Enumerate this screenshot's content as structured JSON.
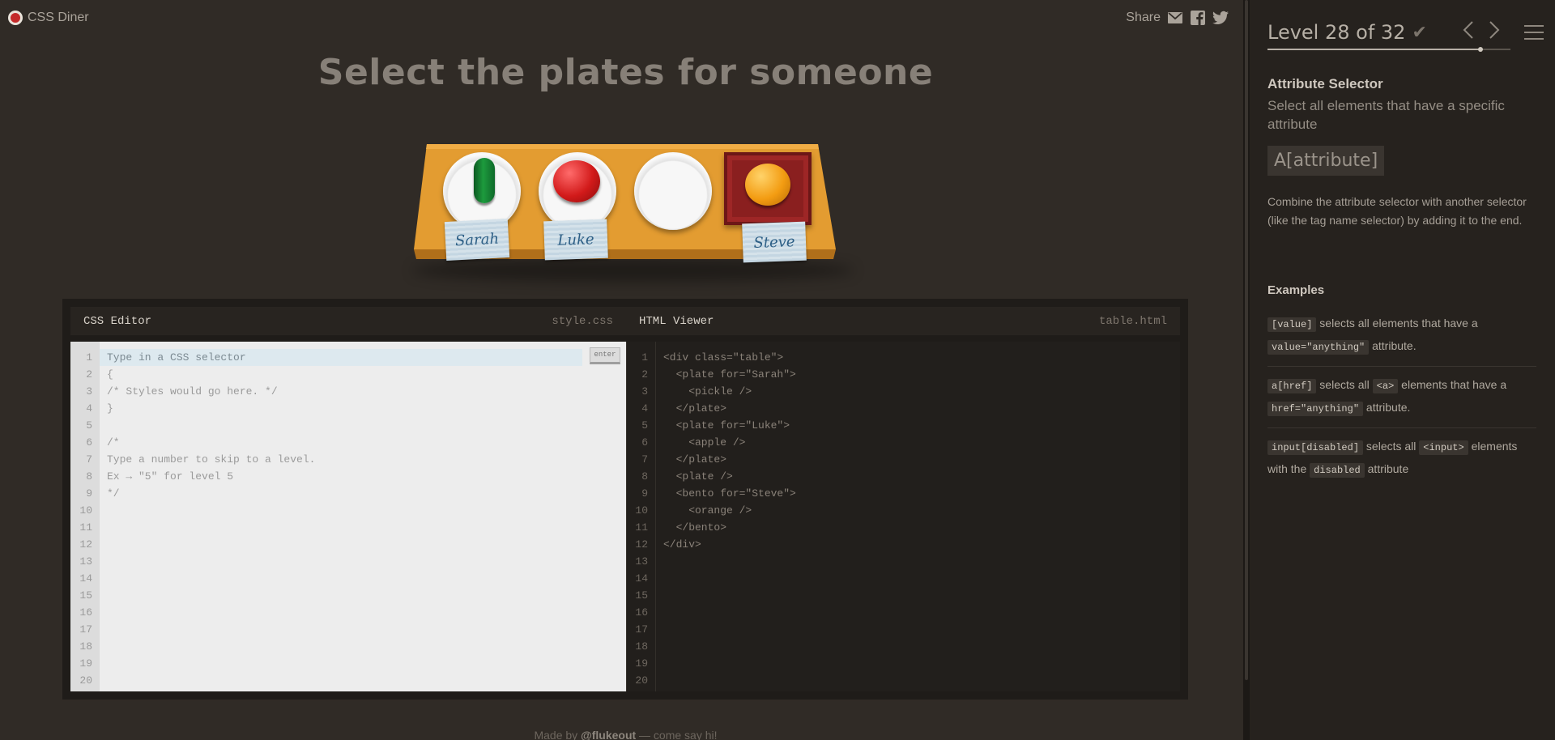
{
  "app": {
    "name": "CSS Diner"
  },
  "share": {
    "label": "Share",
    "icons": [
      "mail-icon",
      "facebook-icon",
      "twitter-icon"
    ]
  },
  "order": "Select the plates for someone",
  "table": {
    "items": [
      {
        "type": "plate",
        "contains": "pickle",
        "tag": "Sarah"
      },
      {
        "type": "plate",
        "contains": "apple",
        "tag": "Luke"
      },
      {
        "type": "plate",
        "contains": "",
        "tag": ""
      },
      {
        "type": "bento",
        "contains": "orange",
        "tag": "Steve"
      }
    ]
  },
  "css_editor": {
    "title": "CSS Editor",
    "file": "style.css",
    "placeholder": "Type in a CSS selector",
    "enter_label": "enter",
    "line_numbers": [
      "1",
      "2",
      "3",
      "4",
      "5",
      "6",
      "7",
      "8",
      "9",
      "10",
      "11",
      "12",
      "13",
      "14",
      "15",
      "16",
      "17",
      "18",
      "19",
      "20"
    ],
    "lines": [
      "",
      "{",
      "/* Styles would go here. */",
      "}",
      "",
      "/*",
      "Type a number to skip to a level.",
      "Ex → \"5\" for level 5",
      "*/"
    ]
  },
  "html_viewer": {
    "title": "HTML Viewer",
    "file": "table.html",
    "line_numbers": [
      "1",
      "2",
      "3",
      "4",
      "5",
      "6",
      "7",
      "8",
      "9",
      "10",
      "11",
      "12",
      "13",
      "14",
      "15",
      "16",
      "17",
      "18",
      "19",
      "20"
    ],
    "lines": [
      "<div class=\"table\">",
      "  <plate for=\"Sarah\">",
      "    <pickle />",
      "  </plate>",
      "  <plate for=\"Luke\">",
      "    <apple />",
      "  </plate>",
      "  <plate />",
      "  <bento for=\"Steve\">",
      "    <orange />",
      "  </bento>",
      "</div>"
    ]
  },
  "footer": {
    "prefix": "Made by ",
    "author": "@flukeout",
    "suffix": " — come say hi!"
  },
  "sidebar": {
    "level_title": "Level 28 of 32",
    "progress": 0.875,
    "selector_name": "Attribute Selector",
    "selector_title": "Select all elements that have a specific attribute",
    "syntax": "A[attribute]",
    "hint": "Combine the attribute selector with another selector (like the tag name selector) by adding it to the end.",
    "examples_heading": "Examples",
    "examples": [
      {
        "code1": "[value]",
        "text1": " selects all elements that have a ",
        "code2": "value=\"anything\"",
        "text2": " attribute."
      },
      {
        "code1": "a[href]",
        "text1": " selects all ",
        "code2": "<a>",
        "text2": " elements that have a ",
        "code3": "href=\"anything\"",
        "text3": " attribute."
      },
      {
        "code1": "input[disabled]",
        "text1": " selects all ",
        "code2": "<input>",
        "text2": " elements with the ",
        "code3": "disabled",
        "text3": " attribute"
      }
    ]
  }
}
